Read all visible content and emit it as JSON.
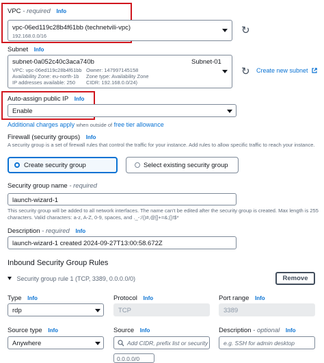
{
  "vpc": {
    "label": "VPC",
    "required": "- required",
    "info": "Info",
    "value": "vpc-06ed119c28b4f61bb (technetvili-vpc)",
    "cidr": "192.168.0.0/16"
  },
  "subnet": {
    "label": "Subnet",
    "info": "Info",
    "id": "subnet-0a052c40c3aca740b",
    "name": "Subnet-01",
    "vpc_line": "VPC: vpc-06ed119c28b4f61bb",
    "owner_line": "Owner: 147997145158",
    "az_line": "Availability Zone: eu-north-1b",
    "zone_type_line": "Zone type: Availability Zone",
    "ip_line": "IP addresses available: 250",
    "cidr_line": "CIDR: 192.168.0.0/24)",
    "create_link": "Create new subnet"
  },
  "public_ip": {
    "label": "Auto-assign public IP",
    "info": "Info",
    "value": "Enable",
    "charges_link": "Additional charges apply",
    "charges_mid": "when outside of",
    "free_tier_link": "free tier allowance"
  },
  "firewall": {
    "label": "Firewall (security groups)",
    "info": "Info",
    "description": "A security group is a set of firewall rules that control the traffic for your instance. Add rules to allow specific traffic to reach your instance.",
    "option_create": "Create security group",
    "option_existing": "Select existing security group"
  },
  "sg_name": {
    "label": "Security group name",
    "required": "- required",
    "value": "launch-wizard-1",
    "hint": "This security group will be added to all network interfaces. The name can't be edited after the security group is created. Max length is 255 characters. Valid characters: a-z, A-Z, 0-9, spaces, and ._-:/()#,@[]+=&;{}!$*"
  },
  "sg_desc": {
    "label": "Description",
    "required": "- required",
    "info": "Info",
    "value": "launch-wizard-1 created 2024-09-27T13:00:58.672Z"
  },
  "inbound": {
    "title": "Inbound Security Group Rules",
    "rule_title": "Security group rule 1 (TCP, 3389, 0.0.0.0/0)",
    "remove_button": "Remove",
    "type_label": "Type",
    "type_info": "Info",
    "type_value": "rdp",
    "protocol_label": "Protocol",
    "protocol_info": "Info",
    "protocol_value": "TCP",
    "port_label": "Port range",
    "port_info": "Info",
    "port_value": "3389",
    "source_type_label": "Source type",
    "source_type_info": "Info",
    "source_type_value": "Anywhere",
    "source_label": "Source",
    "source_info": "Info",
    "source_placeholder": "Add CIDR, prefix list or security",
    "source_chip": "0.0.0.0/0",
    "description_label": "Description",
    "description_optional": "- optional",
    "description_info": "Info",
    "description_placeholder": "e.g. SSH for admin desktop"
  },
  "colors": {
    "link": "#0972d3",
    "highlight": "#d0151d",
    "selected_border": "#0972d3"
  }
}
